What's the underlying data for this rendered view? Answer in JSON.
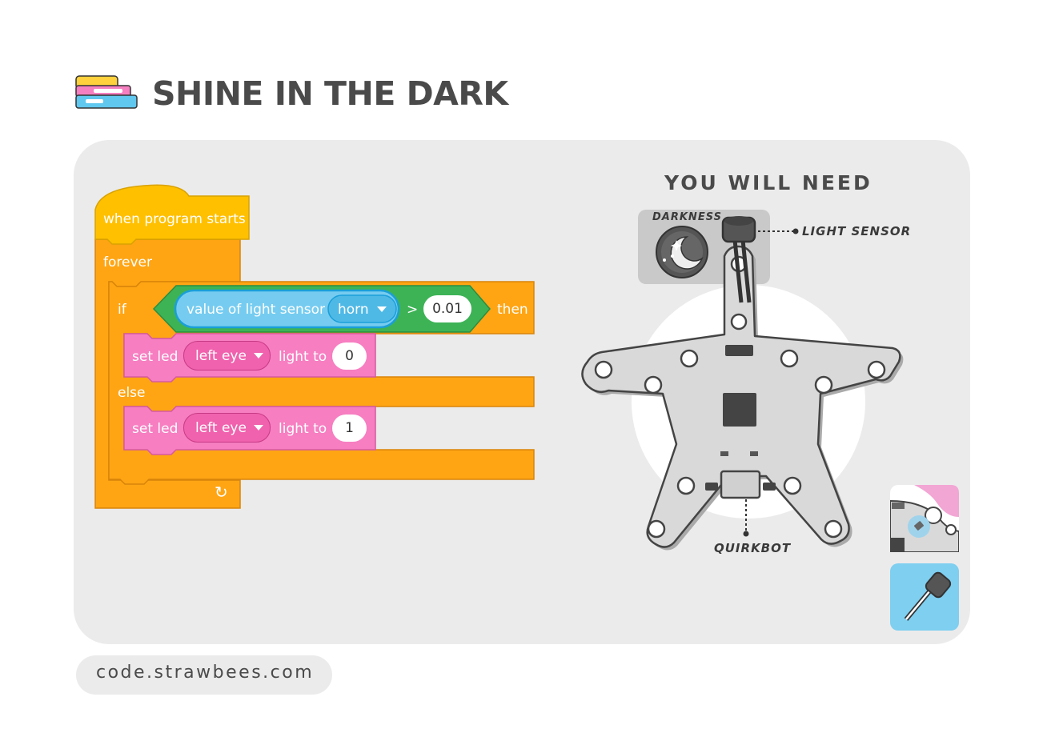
{
  "header": {
    "title": "SHINE IN THE DARK"
  },
  "program": {
    "hat_label": "when program starts",
    "forever_label": "forever",
    "if_label": "if",
    "then_label": "then",
    "else_label": "else",
    "condition": {
      "sensor_label": "value of light sensor",
      "sensor_port": "horn",
      "operator": ">",
      "threshold": "0.01"
    },
    "then_action": {
      "label": "set led",
      "target": "left eye",
      "suffix": "light to",
      "value": "0"
    },
    "else_action": {
      "label": "set led",
      "target": "left eye",
      "suffix": "light to",
      "value": "1"
    },
    "loop_arrow": "↻"
  },
  "requirements": {
    "title": "YOU WILL NEED",
    "darkness_label": "DARKNESS",
    "light_sensor_label": "LIGHT SENSOR",
    "quirkbot_label": "QUIRKBOT"
  },
  "footer": {
    "url": "code.strawbees.com"
  },
  "colors": {
    "hat_block": "#ffc000",
    "control_block": "#ffa514",
    "operator_block": "#3db356",
    "sensor_block": "#76ccf0",
    "led_block": "#f67ec1",
    "card_background": "#ebebeb",
    "title_text": "#4a4a4a"
  }
}
